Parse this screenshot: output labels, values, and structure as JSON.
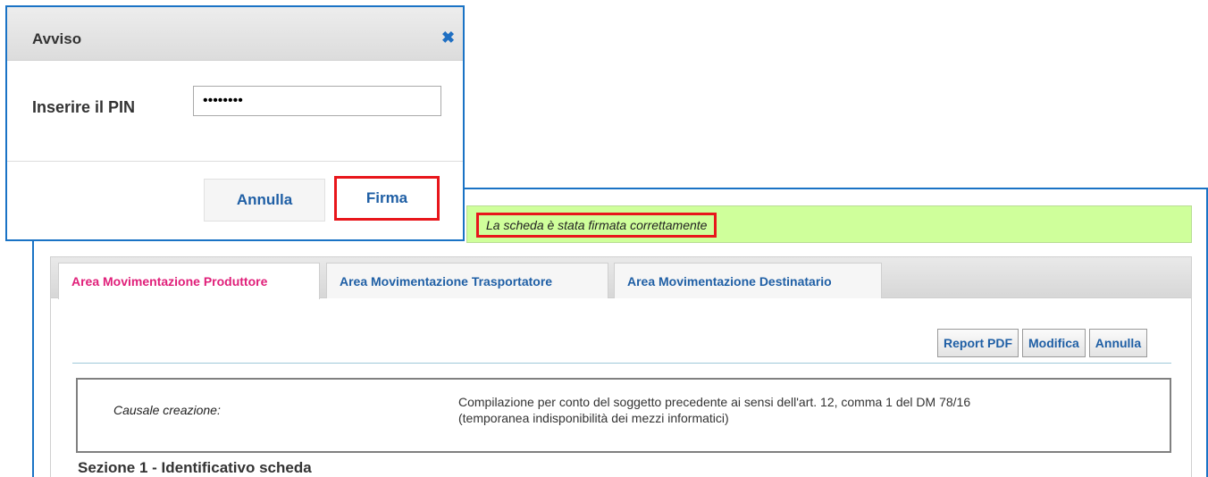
{
  "dialog": {
    "title": "Avviso",
    "close_icon": "close-icon",
    "pin_label": "Inserire il PIN",
    "pin_value": "••••••••",
    "cancel_label": "Annulla",
    "sign_label": "Firma"
  },
  "status": {
    "message": "La scheda è stata firmata correttamente"
  },
  "tabs": [
    {
      "label": "Area Movimentazione Produttore",
      "active": true
    },
    {
      "label": "Area Movimentazione Trasportatore",
      "active": false
    },
    {
      "label": "Area Movimentazione Destinatario",
      "active": false
    }
  ],
  "toolbar": {
    "report_label": "Report PDF",
    "edit_label": "Modifica",
    "cancel_label": "Annulla"
  },
  "causale": {
    "label": "Causale creazione:",
    "value_line1": "Compilazione per conto del soggetto precedente ai sensi dell'art. 12, comma 1 del DM 78/16",
    "value_line2": "(temporanea indisponibilità  dei mezzi informatici)"
  },
  "section": {
    "title": "Sezione 1 - Identificativo scheda"
  },
  "colors": {
    "accent_blue": "#1a73c5",
    "highlight_red": "#e8161b",
    "success_green": "#cfff9b",
    "active_tab_pink": "#e0207a"
  }
}
